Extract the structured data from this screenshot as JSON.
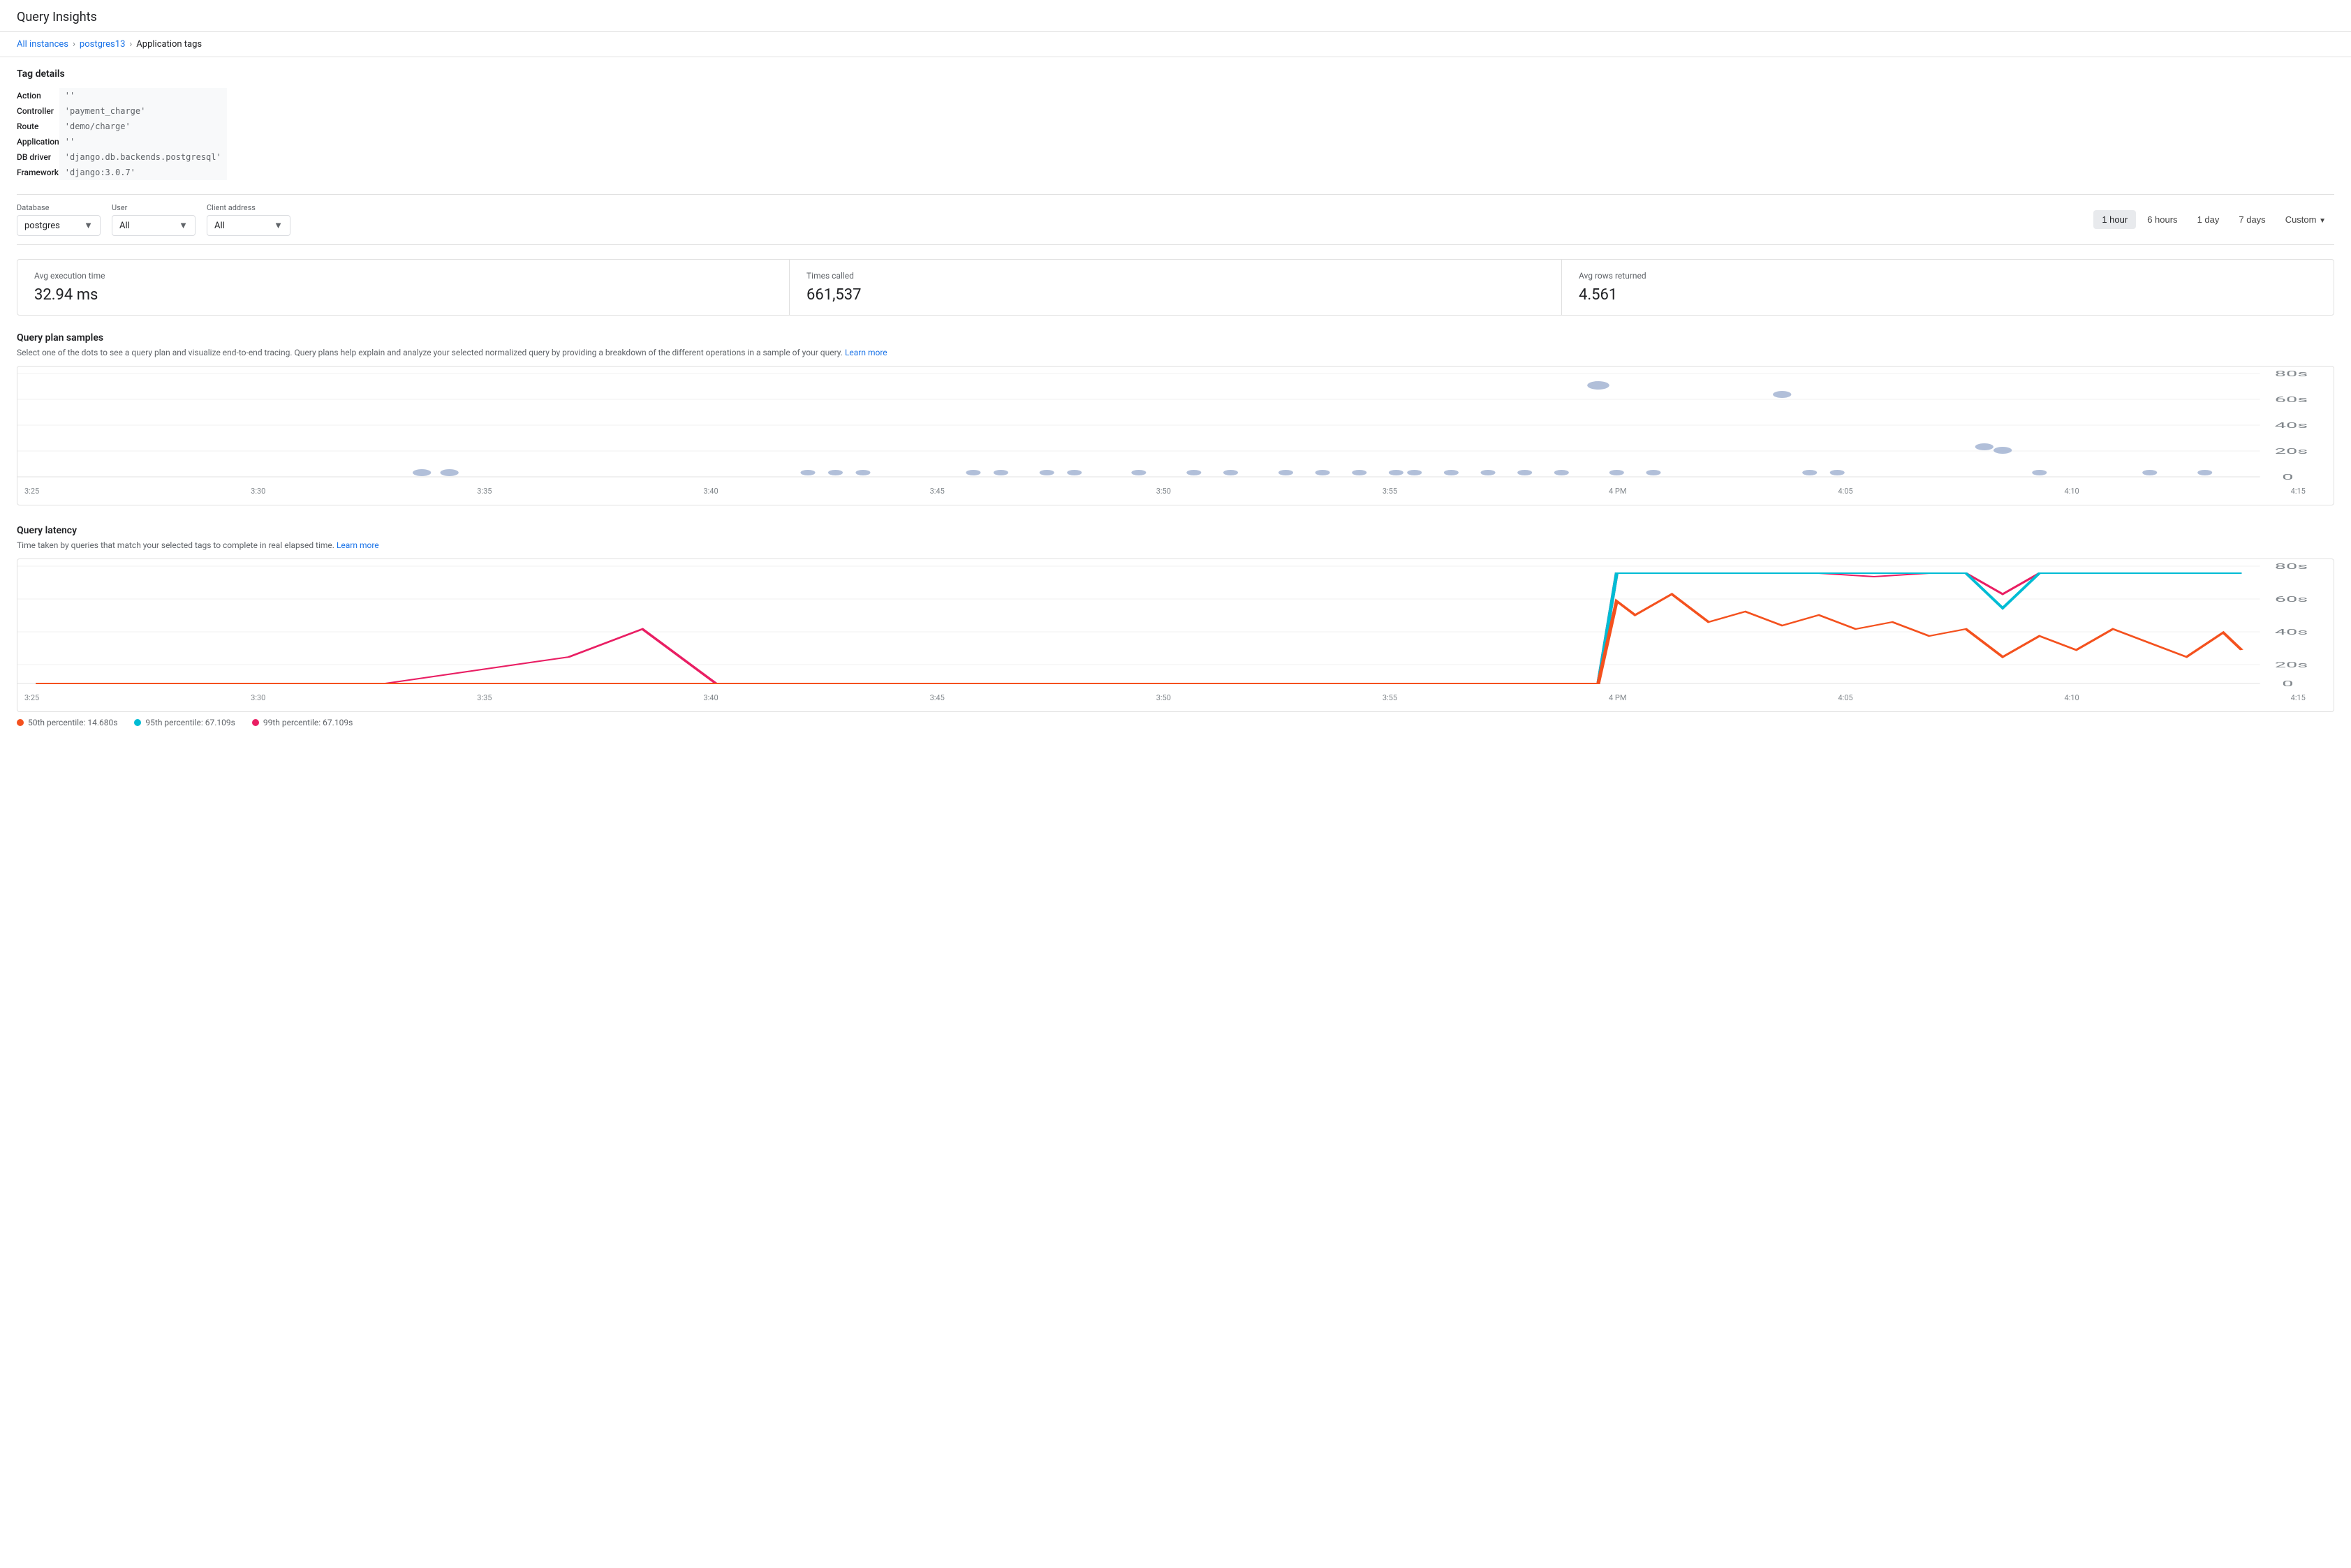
{
  "page": {
    "title": "Query Insights",
    "breadcrumb": {
      "items": [
        "All instances",
        "postgres13",
        "Application tags"
      ]
    }
  },
  "tag_details": {
    "section_title": "Tag details",
    "rows": [
      {
        "label": "Action",
        "value": "''"
      },
      {
        "label": "Controller",
        "value": "'payment_charge'"
      },
      {
        "label": "Route",
        "value": "'demo/charge'"
      },
      {
        "label": "Application",
        "value": "''"
      },
      {
        "label": "DB driver",
        "value": "'django.db.backends.postgresql'"
      },
      {
        "label": "Framework",
        "value": "'django:3.0.7'"
      }
    ]
  },
  "filters": {
    "database": {
      "label": "Database",
      "value": "postgres",
      "options": [
        "postgres"
      ]
    },
    "user": {
      "label": "User",
      "value": "All",
      "options": [
        "All"
      ]
    },
    "client_address": {
      "label": "Client address",
      "value": "All",
      "options": [
        "All"
      ]
    },
    "time_buttons": [
      {
        "label": "1 hour",
        "active": true
      },
      {
        "label": "6 hours",
        "active": false
      },
      {
        "label": "1 day",
        "active": false
      },
      {
        "label": "7 days",
        "active": false
      },
      {
        "label": "Custom",
        "active": false
      }
    ]
  },
  "metrics": [
    {
      "label": "Avg execution time",
      "value": "32.94 ms"
    },
    {
      "label": "Times called",
      "value": "661,537"
    },
    {
      "label": "Avg rows returned",
      "value": "4.561"
    }
  ],
  "query_plan": {
    "title": "Query plan samples",
    "subtitle": "Select one of the dots to see a query plan and visualize end-to-end tracing. Query plans help explain and analyze your selected normalized query by providing a breakdown of the different operations in a sample of your query.",
    "learn_more": "Learn more",
    "y_labels": [
      "80s",
      "60s",
      "40s",
      "20s",
      "0"
    ],
    "x_labels": [
      "3:25",
      "3:30",
      "3:35",
      "3:40",
      "3:45",
      "3:50",
      "3:55",
      "4 PM",
      "4:05",
      "4:10",
      "4:15"
    ]
  },
  "query_latency": {
    "title": "Query latency",
    "subtitle": "Time taken by queries that match your selected tags to complete in real elapsed time.",
    "learn_more": "Learn more",
    "y_labels": [
      "80s",
      "60s",
      "40s",
      "20s",
      "0"
    ],
    "x_labels": [
      "3:25",
      "3:30",
      "3:35",
      "3:40",
      "3:45",
      "3:50",
      "3:55",
      "4 PM",
      "4:05",
      "4:10",
      "4:15"
    ],
    "legend": [
      {
        "label": "50th percentile: 14.680s",
        "color": "#f4511e"
      },
      {
        "label": "95th percentile: 67.109s",
        "color": "#00bcd4"
      },
      {
        "label": "99th percentile: 67.109s",
        "color": "#e91e63"
      }
    ]
  }
}
